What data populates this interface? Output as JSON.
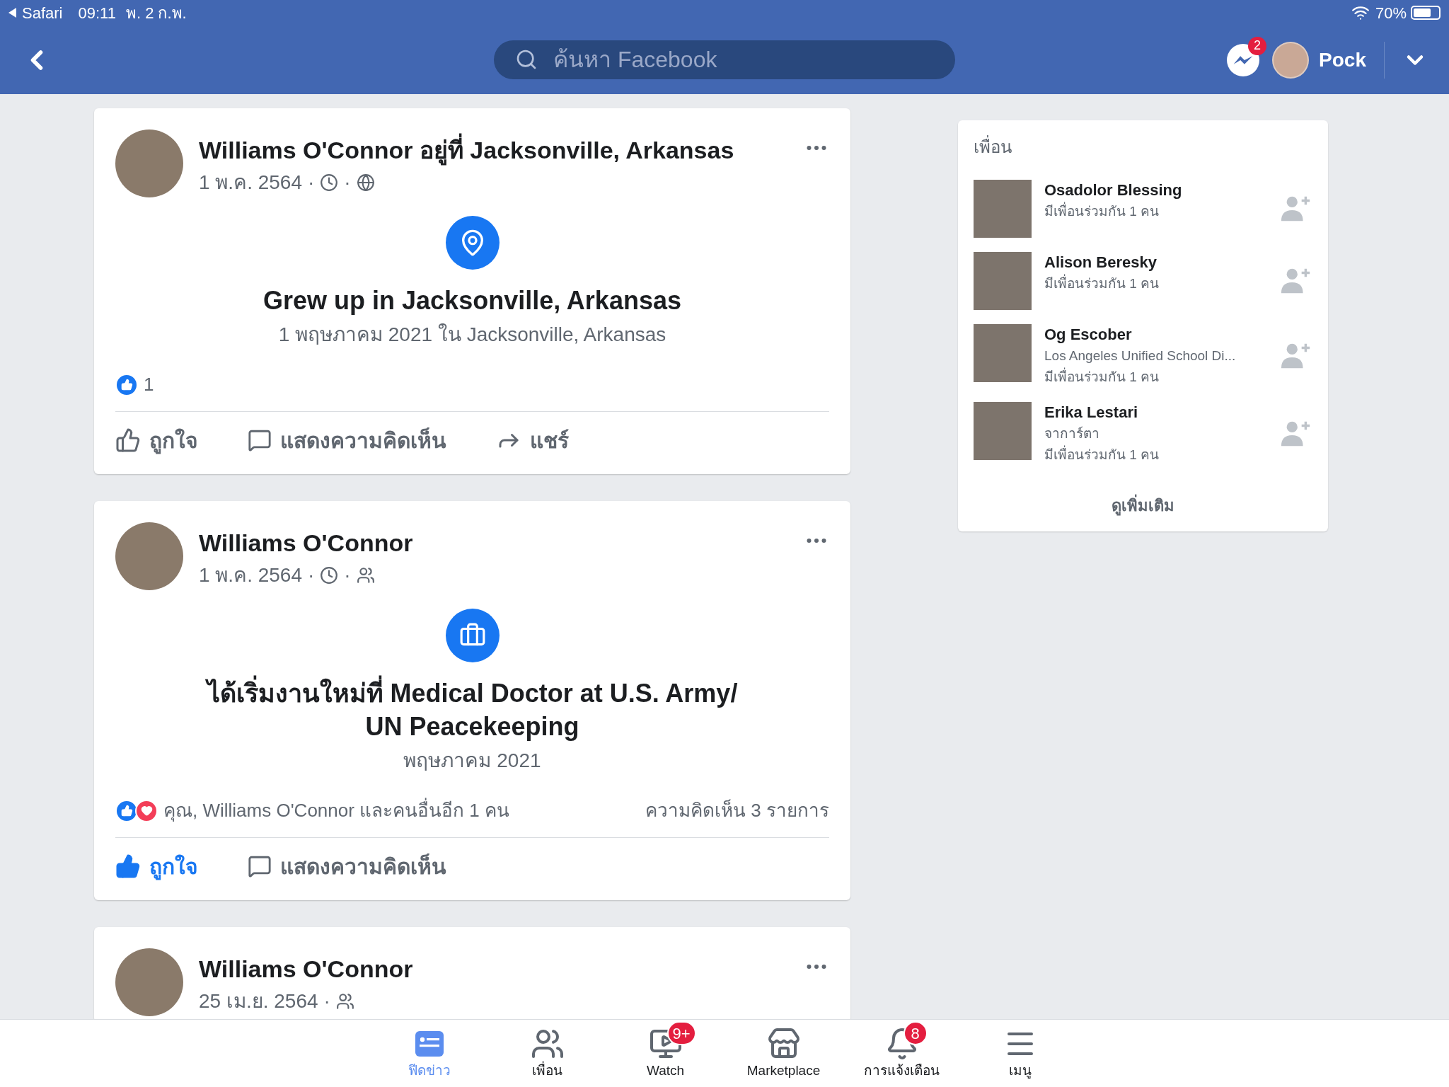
{
  "status_bar": {
    "app": "Safari",
    "time": "09:11",
    "date": "พ. 2 ก.พ.",
    "battery": "70%"
  },
  "top_bar": {
    "search": {
      "placeholder": "ค้นหา Facebook"
    },
    "messenger_badge": "2",
    "user": "Pock"
  },
  "posts": [
    {
      "header": "Williams O'Connor อยู่ที่ Jacksonville, Arkansas",
      "date": "1 พ.ค. 2564",
      "separator": "·",
      "clock": true,
      "audience": {
        "kind": "public"
      },
      "event": {
        "kind": "location",
        "title": "Grew up in Jacksonville, Arkansas",
        "subtitle": "1 พฤษภาคม  2021 ใน Jacksonville, Arkansas"
      },
      "reactions": {
        "icons": [
          {
            "kind": "like"
          }
        ],
        "text": "1"
      },
      "actions": [
        {
          "kind": "like",
          "label": "ถูกใจ",
          "selected": false
        },
        {
          "kind": "comment",
          "label": "แสดงความคิดเห็น",
          "selected": false
        },
        {
          "kind": "share",
          "label": "แชร์",
          "selected": false
        }
      ]
    },
    {
      "header": "Williams O'Connor",
      "date": "1 พ.ค. 2564",
      "separator": "·",
      "clock": true,
      "audience": {
        "kind": "friends"
      },
      "event": {
        "kind": "work",
        "title": "ได้เริ่มงานใหม่ที่ Medical Doctor at U.S. Army/ UN Peacekeeping",
        "subtitle": "พฤษภาคม  2021"
      },
      "reactions": {
        "icons": [
          {
            "kind": "like"
          },
          {
            "kind": "love"
          }
        ],
        "text": "คุณ, Williams O'Connor และคนอื่นอีก 1 คน",
        "comments": "ความคิดเห็น 3 รายการ"
      },
      "actions": [
        {
          "kind": "like",
          "label": "ถูกใจ",
          "selected": true
        },
        {
          "kind": "comment",
          "label": "แสดงความคิดเห็น",
          "selected": false
        }
      ]
    },
    {
      "header": "Williams O'Connor",
      "date": "25 เม.ย. 2564",
      "separator": "·",
      "clock": false,
      "audience": {
        "kind": "friends"
      }
    }
  ],
  "friends_panel": {
    "title": "เพื่อน",
    "items": [
      {
        "name": "Osadolor Blessing",
        "lines": [
          "มีเพื่อนร่วมกัน 1 คน"
        ]
      },
      {
        "name": "Alison Beresky",
        "lines": [
          "มีเพื่อนร่วมกัน 1 คน"
        ]
      },
      {
        "name": "Og Escober",
        "lines": [
          "Los Angeles Unified School Di...",
          "มีเพื่อนร่วมกัน 1 คน"
        ]
      },
      {
        "name": "Erika Lestari",
        "lines": [
          "จาการ์ตา",
          "มีเพื่อนร่วมกัน 1 คน"
        ]
      }
    ],
    "more": "ดูเพิ่มเติม"
  },
  "bottom_nav": [
    {
      "kind": "feed",
      "label": "ฟีดข่าว",
      "selected": true
    },
    {
      "kind": "friends",
      "label": "เพื่อน",
      "selected": false
    },
    {
      "kind": "watch",
      "label": "Watch",
      "badge": "9+",
      "selected": false
    },
    {
      "kind": "marketplace",
      "label": "Marketplace",
      "selected": false
    },
    {
      "kind": "notifications",
      "label": "การแจ้งเตือน",
      "badge": "8",
      "selected": false
    },
    {
      "kind": "menu",
      "label": "เมนู",
      "selected": false
    }
  ]
}
